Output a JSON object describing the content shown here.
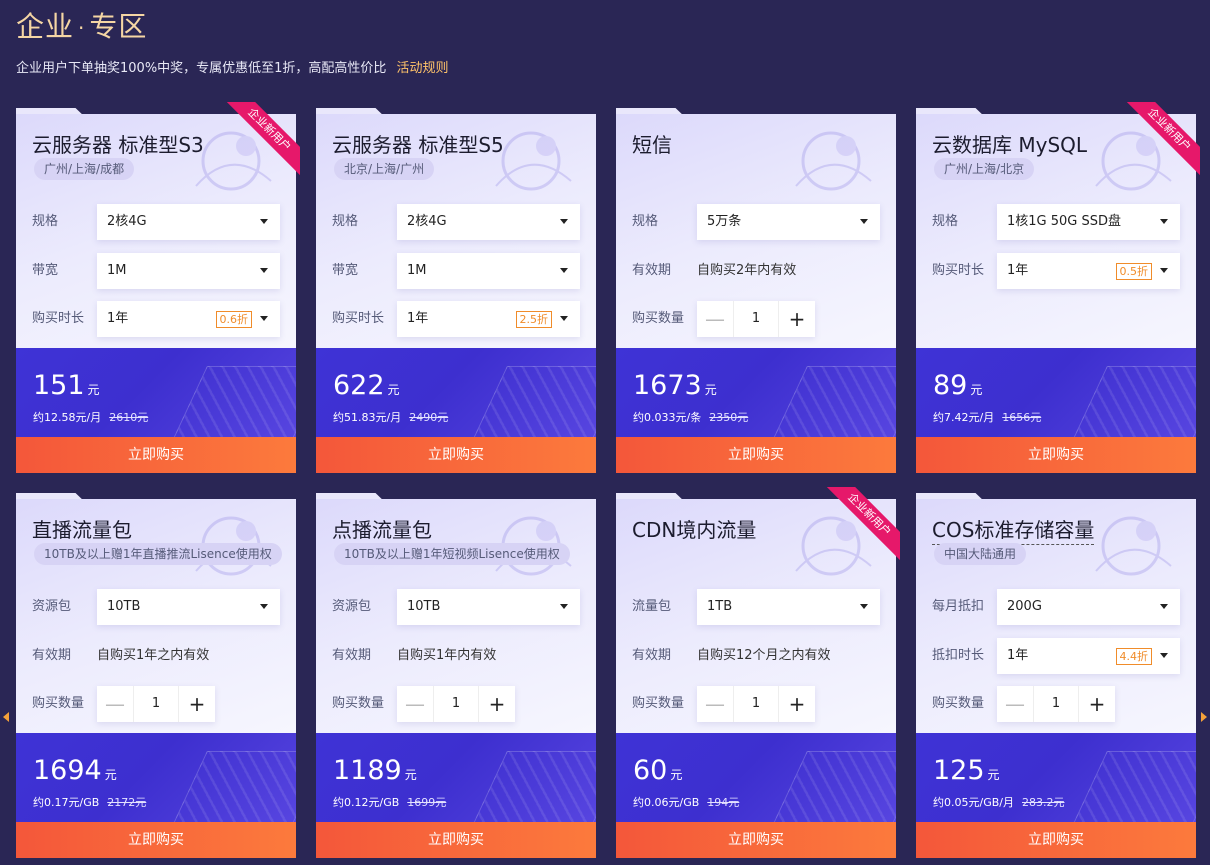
{
  "header": {
    "title_a": "企业",
    "title_dot": "·",
    "title_b": "专区",
    "subtitle": "企业用户下单抽奖100%中奖，专属优惠低至1折，高配高性价比",
    "rules_link": "活动规则"
  },
  "buy_label": "立即购买",
  "cards": [
    {
      "title": "云服务器 标准型S3",
      "tag": "广州/上海/成都",
      "ribbon": "企业新用户",
      "rows": [
        {
          "label": "规格",
          "value": "2核4G"
        },
        {
          "label": "带宽",
          "value": "1M"
        },
        {
          "label": "购买时长",
          "value": "1年",
          "discount": "0.6折"
        }
      ],
      "price": "151",
      "unit": "元",
      "per": "约12.58元/月",
      "original": "2610元"
    },
    {
      "title": "云服务器 标准型S5",
      "tag": "北京/上海/广州",
      "rows": [
        {
          "label": "规格",
          "value": "2核4G"
        },
        {
          "label": "带宽",
          "value": "1M"
        },
        {
          "label": "购买时长",
          "value": "1年",
          "discount": "2.5折"
        }
      ],
      "price": "622",
      "unit": "元",
      "per": "约51.83元/月",
      "original": "2490元"
    },
    {
      "title": "短信",
      "rows": [
        {
          "label": "规格",
          "value": "5万条"
        },
        {
          "label": "有效期",
          "text": "自购买2年内有效"
        },
        {
          "label": "购买数量",
          "qty": "1",
          "minus": "—",
          "plus": "+"
        }
      ],
      "price": "1673",
      "unit": "元",
      "per": "约0.033元/条",
      "original": "2350元"
    },
    {
      "title": "云数据库 MySQL",
      "tag": "广州/上海/北京",
      "ribbon": "企业新用户",
      "rows": [
        {
          "label": "规格",
          "value": "1核1G 50G SSD盘"
        },
        {
          "label": "购买时长",
          "value": "1年",
          "discount": "0.5折"
        }
      ],
      "price": "89",
      "unit": "元",
      "per": "约7.42元/月",
      "original": "1656元"
    },
    {
      "title": "直播流量包",
      "tag": "10TB及以上赠1年直播推流Lisence使用权",
      "rows": [
        {
          "label": "资源包",
          "value": "10TB"
        },
        {
          "label": "有效期",
          "text": "自购买1年之内有效"
        },
        {
          "label": "购买数量",
          "qty": "1",
          "minus": "—",
          "plus": "+"
        }
      ],
      "price": "1694",
      "unit": "元",
      "per": "约0.17元/GB",
      "original": "2172元"
    },
    {
      "title": "点播流量包",
      "tag": "10TB及以上赠1年短视频Lisence使用权",
      "rows": [
        {
          "label": "资源包",
          "value": "10TB"
        },
        {
          "label": "有效期",
          "text": "自购买1年内有效"
        },
        {
          "label": "购买数量",
          "qty": "1",
          "minus": "—",
          "plus": "+"
        }
      ],
      "price": "1189",
      "unit": "元",
      "per": "约0.12元/GB",
      "original": "1699元"
    },
    {
      "title": "CDN境内流量",
      "ribbon": "企业新用户",
      "rows": [
        {
          "label": "流量包",
          "value": "1TB"
        },
        {
          "label": "有效期",
          "text": "自购买12个月之内有效"
        },
        {
          "label": "购买数量",
          "qty": "1",
          "minus": "—",
          "plus": "+"
        }
      ],
      "price": "60",
      "unit": "元",
      "per": "约0.06元/GB",
      "original": "194元"
    },
    {
      "title": "COS标准存储容量",
      "tag": "中国大陆通用",
      "dashed": true,
      "rows": [
        {
          "label": "每月抵扣",
          "value": "200G"
        },
        {
          "label": "抵扣时长",
          "value": "1年",
          "discount": "4.4折"
        },
        {
          "label": "购买数量",
          "qty": "1",
          "minus": "—",
          "plus": "+"
        }
      ],
      "price": "125",
      "unit": "元",
      "per": "约0.05元/GB/月",
      "original": "283.2元"
    }
  ]
}
